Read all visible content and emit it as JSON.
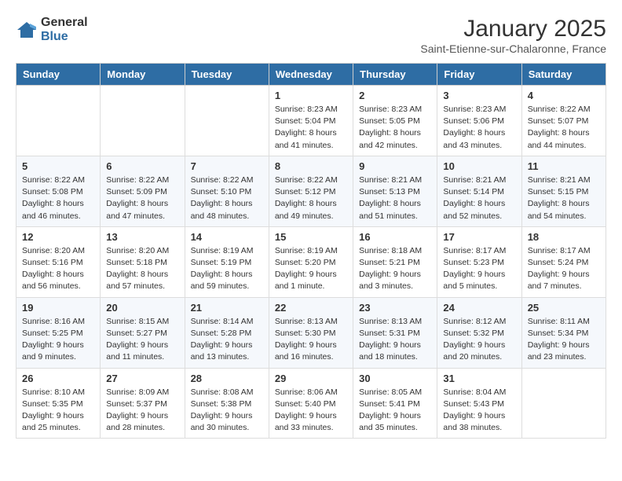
{
  "header": {
    "logo_general": "General",
    "logo_blue": "Blue",
    "month_title": "January 2025",
    "subtitle": "Saint-Etienne-sur-Chalaronne, France"
  },
  "weekdays": [
    "Sunday",
    "Monday",
    "Tuesday",
    "Wednesday",
    "Thursday",
    "Friday",
    "Saturday"
  ],
  "weeks": [
    [
      {
        "day": "",
        "info": ""
      },
      {
        "day": "",
        "info": ""
      },
      {
        "day": "",
        "info": ""
      },
      {
        "day": "1",
        "info": "Sunrise: 8:23 AM\nSunset: 5:04 PM\nDaylight: 8 hours and 41 minutes."
      },
      {
        "day": "2",
        "info": "Sunrise: 8:23 AM\nSunset: 5:05 PM\nDaylight: 8 hours and 42 minutes."
      },
      {
        "day": "3",
        "info": "Sunrise: 8:23 AM\nSunset: 5:06 PM\nDaylight: 8 hours and 43 minutes."
      },
      {
        "day": "4",
        "info": "Sunrise: 8:22 AM\nSunset: 5:07 PM\nDaylight: 8 hours and 44 minutes."
      }
    ],
    [
      {
        "day": "5",
        "info": "Sunrise: 8:22 AM\nSunset: 5:08 PM\nDaylight: 8 hours and 46 minutes."
      },
      {
        "day": "6",
        "info": "Sunrise: 8:22 AM\nSunset: 5:09 PM\nDaylight: 8 hours and 47 minutes."
      },
      {
        "day": "7",
        "info": "Sunrise: 8:22 AM\nSunset: 5:10 PM\nDaylight: 8 hours and 48 minutes."
      },
      {
        "day": "8",
        "info": "Sunrise: 8:22 AM\nSunset: 5:12 PM\nDaylight: 8 hours and 49 minutes."
      },
      {
        "day": "9",
        "info": "Sunrise: 8:21 AM\nSunset: 5:13 PM\nDaylight: 8 hours and 51 minutes."
      },
      {
        "day": "10",
        "info": "Sunrise: 8:21 AM\nSunset: 5:14 PM\nDaylight: 8 hours and 52 minutes."
      },
      {
        "day": "11",
        "info": "Sunrise: 8:21 AM\nSunset: 5:15 PM\nDaylight: 8 hours and 54 minutes."
      }
    ],
    [
      {
        "day": "12",
        "info": "Sunrise: 8:20 AM\nSunset: 5:16 PM\nDaylight: 8 hours and 56 minutes."
      },
      {
        "day": "13",
        "info": "Sunrise: 8:20 AM\nSunset: 5:18 PM\nDaylight: 8 hours and 57 minutes."
      },
      {
        "day": "14",
        "info": "Sunrise: 8:19 AM\nSunset: 5:19 PM\nDaylight: 8 hours and 59 minutes."
      },
      {
        "day": "15",
        "info": "Sunrise: 8:19 AM\nSunset: 5:20 PM\nDaylight: 9 hours and 1 minute."
      },
      {
        "day": "16",
        "info": "Sunrise: 8:18 AM\nSunset: 5:21 PM\nDaylight: 9 hours and 3 minutes."
      },
      {
        "day": "17",
        "info": "Sunrise: 8:17 AM\nSunset: 5:23 PM\nDaylight: 9 hours and 5 minutes."
      },
      {
        "day": "18",
        "info": "Sunrise: 8:17 AM\nSunset: 5:24 PM\nDaylight: 9 hours and 7 minutes."
      }
    ],
    [
      {
        "day": "19",
        "info": "Sunrise: 8:16 AM\nSunset: 5:25 PM\nDaylight: 9 hours and 9 minutes."
      },
      {
        "day": "20",
        "info": "Sunrise: 8:15 AM\nSunset: 5:27 PM\nDaylight: 9 hours and 11 minutes."
      },
      {
        "day": "21",
        "info": "Sunrise: 8:14 AM\nSunset: 5:28 PM\nDaylight: 9 hours and 13 minutes."
      },
      {
        "day": "22",
        "info": "Sunrise: 8:13 AM\nSunset: 5:30 PM\nDaylight: 9 hours and 16 minutes."
      },
      {
        "day": "23",
        "info": "Sunrise: 8:13 AM\nSunset: 5:31 PM\nDaylight: 9 hours and 18 minutes."
      },
      {
        "day": "24",
        "info": "Sunrise: 8:12 AM\nSunset: 5:32 PM\nDaylight: 9 hours and 20 minutes."
      },
      {
        "day": "25",
        "info": "Sunrise: 8:11 AM\nSunset: 5:34 PM\nDaylight: 9 hours and 23 minutes."
      }
    ],
    [
      {
        "day": "26",
        "info": "Sunrise: 8:10 AM\nSunset: 5:35 PM\nDaylight: 9 hours and 25 minutes."
      },
      {
        "day": "27",
        "info": "Sunrise: 8:09 AM\nSunset: 5:37 PM\nDaylight: 9 hours and 28 minutes."
      },
      {
        "day": "28",
        "info": "Sunrise: 8:08 AM\nSunset: 5:38 PM\nDaylight: 9 hours and 30 minutes."
      },
      {
        "day": "29",
        "info": "Sunrise: 8:06 AM\nSunset: 5:40 PM\nDaylight: 9 hours and 33 minutes."
      },
      {
        "day": "30",
        "info": "Sunrise: 8:05 AM\nSunset: 5:41 PM\nDaylight: 9 hours and 35 minutes."
      },
      {
        "day": "31",
        "info": "Sunrise: 8:04 AM\nSunset: 5:43 PM\nDaylight: 9 hours and 38 minutes."
      },
      {
        "day": "",
        "info": ""
      }
    ]
  ]
}
